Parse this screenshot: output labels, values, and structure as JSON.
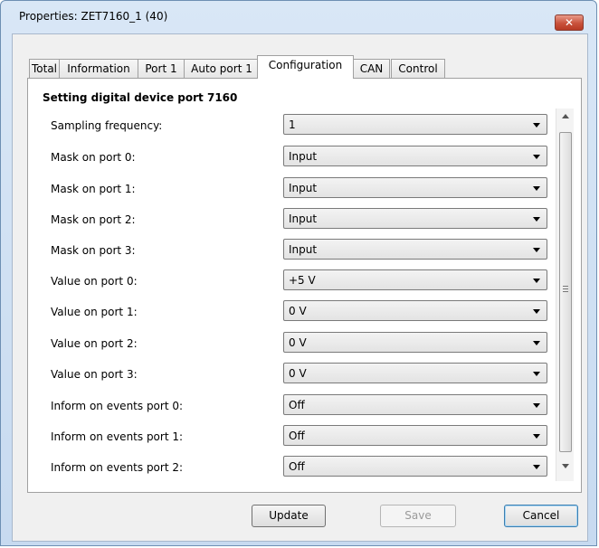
{
  "window": {
    "title": "Properties: ZET7160_1 (40)",
    "close_glyph": "✕"
  },
  "tabs": [
    {
      "label": "Total"
    },
    {
      "label": "Information"
    },
    {
      "label": "Port 1"
    },
    {
      "label": "Auto port 1"
    },
    {
      "label": "Configuration"
    },
    {
      "label": "CAN"
    },
    {
      "label": "Control"
    }
  ],
  "active_tab": "Configuration",
  "section": {
    "heading": "Setting digital device port 7160"
  },
  "rows": [
    {
      "label": "Sampling frequency:",
      "value": "1"
    },
    {
      "label": "Mask on port 0:",
      "value": "Input"
    },
    {
      "label": "Mask on port 1:",
      "value": "Input"
    },
    {
      "label": "Mask on port 2:",
      "value": "Input"
    },
    {
      "label": "Mask on port 3:",
      "value": "Input"
    },
    {
      "label": "Value on port 0:",
      "value": "+5 V"
    },
    {
      "label": "Value on port 1:",
      "value": "0 V"
    },
    {
      "label": "Value on port 2:",
      "value": "0 V"
    },
    {
      "label": "Value on port 3:",
      "value": "0 V"
    },
    {
      "label": "Inform on events port 0:",
      "value": "Off"
    },
    {
      "label": "Inform on events port 1:",
      "value": "Off"
    },
    {
      "label": "Inform on events port 2:",
      "value": "Off"
    }
  ],
  "buttons": {
    "update": "Update",
    "save": "Save",
    "cancel": "Cancel"
  },
  "colors": {
    "close_button": "#c9523c",
    "titlebar": "#d9e7f6",
    "default_button_border": "#3c7fb1"
  }
}
